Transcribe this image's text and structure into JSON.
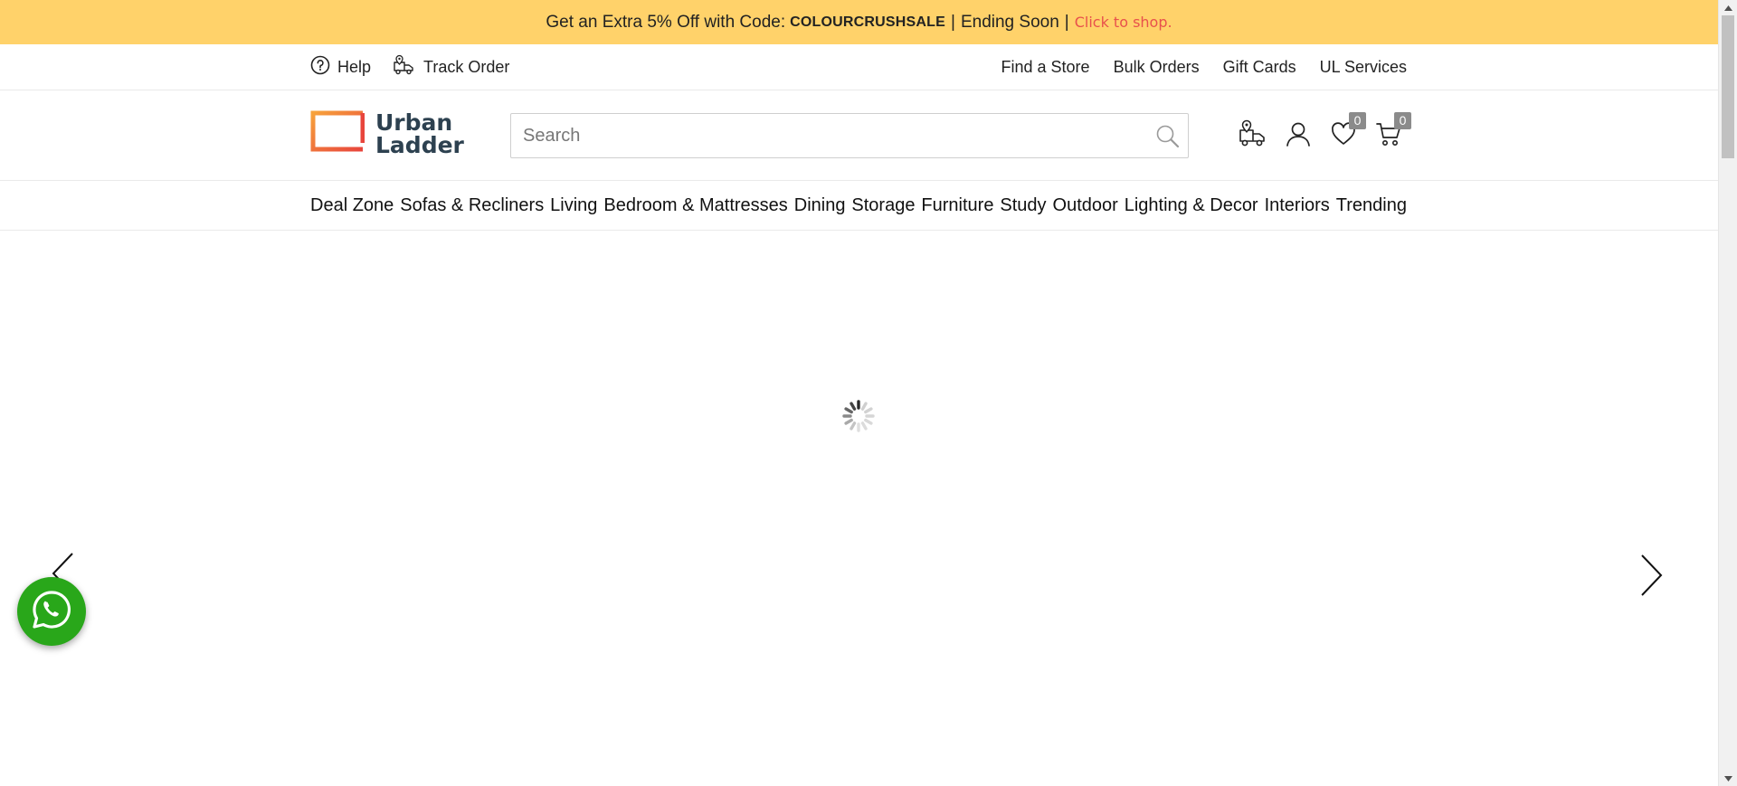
{
  "promo": {
    "prefix": "Get an Extra 5% Off with Code:",
    "code": "COLOURCRUSHSALE",
    "sep1": "|",
    "middle": "Ending Soon",
    "sep2": "|",
    "cta": "Click to shop.",
    "bg_color": "#ffd26a",
    "cta_color": "#e8514c"
  },
  "utility": {
    "left": [
      {
        "label": "Help",
        "icon": "help-circle-icon"
      },
      {
        "label": "Track Order",
        "icon": "delivery-truck-pin-icon"
      }
    ],
    "right": [
      "Find a Store",
      "Bulk Orders",
      "Gift Cards",
      "UL Services"
    ]
  },
  "header": {
    "logo_line1": "Urban",
    "logo_line2": "Ladder",
    "search_placeholder": "Search",
    "wishlist_count": "0",
    "cart_count": "0"
  },
  "nav": {
    "items": [
      "Deal Zone",
      "Sofas & Recliners",
      "Living",
      "Bedroom & Mattresses",
      "Dining",
      "Storage",
      "Furniture",
      "Study",
      "Outdoor",
      "Lighting & Decor",
      "Interiors",
      "Trending"
    ]
  },
  "hero": {
    "state": "loading"
  },
  "colors": {
    "whatsapp": "#29a71a",
    "brand_text": "#2d4150",
    "badge": "#8b8b8b"
  }
}
